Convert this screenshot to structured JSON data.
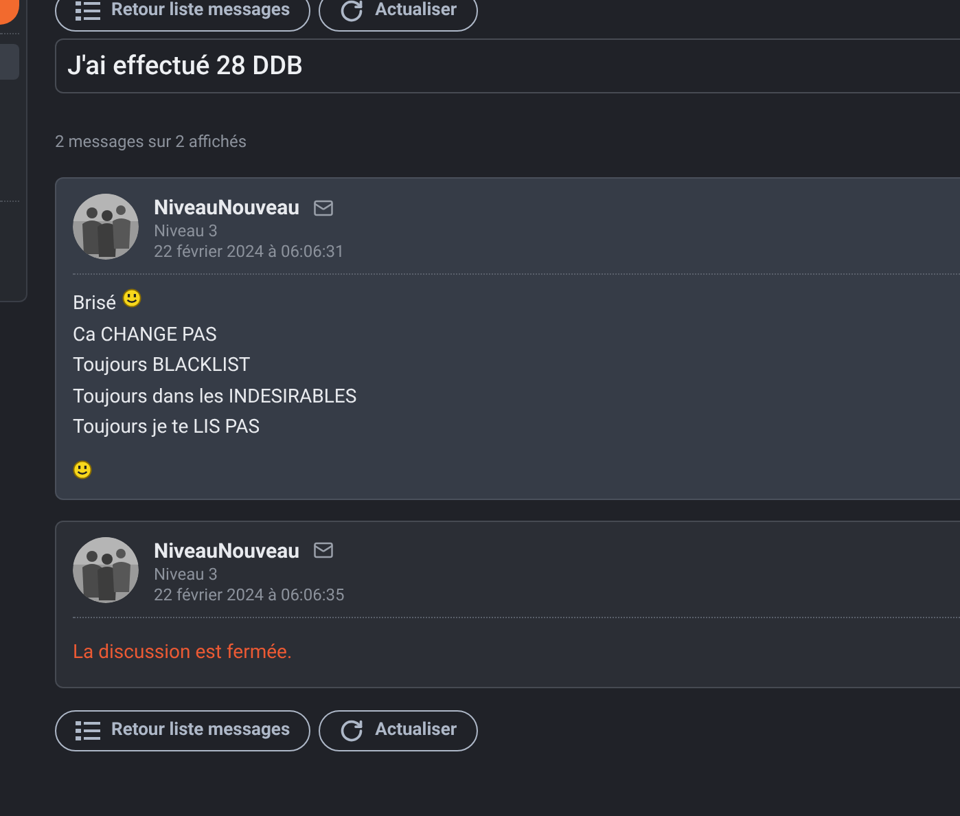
{
  "top_buttons": [
    {
      "kind": "list",
      "label": "Retour liste messages"
    },
    {
      "kind": "refresh",
      "label": "Actualiser"
    }
  ],
  "title": "J'ai effectué 28 DDB",
  "count": "2 messages sur 2 affichés",
  "messages": [
    {
      "kind": "post",
      "author": "NiveauNouveau",
      "level": "Niveau 3",
      "date": "22 février 2024 à 06:06:31",
      "body": [
        {
          "kind": "text",
          "text": "Brisé",
          "emoji": true
        },
        {
          "kind": "text",
          "text": "Ca CHANGE PAS",
          "emoji": false
        },
        {
          "kind": "text",
          "text": "Toujours BLACKLIST",
          "emoji": false
        },
        {
          "kind": "text",
          "text": "Toujours dans les INDESIRABLES",
          "emoji": false
        },
        {
          "kind": "text",
          "text": "Toujours je te LIS PAS",
          "emoji": false
        },
        {
          "kind": "emoji"
        }
      ]
    },
    {
      "kind": "closed",
      "author": "NiveauNouveau",
      "level": "Niveau 3",
      "date": "22 février 2024 à 06:06:35",
      "notice": "La discussion est fermée."
    }
  ],
  "bottom_buttons": [
    {
      "kind": "list",
      "label": "Retour liste messages"
    },
    {
      "kind": "refresh",
      "label": "Actualiser"
    }
  ]
}
